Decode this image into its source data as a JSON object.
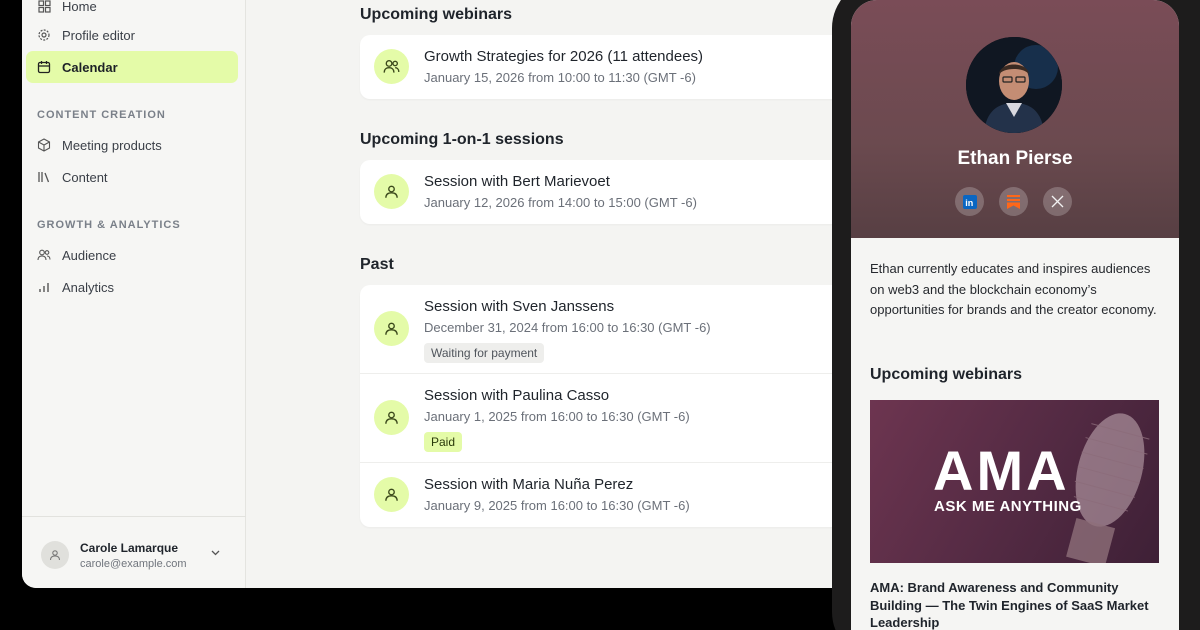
{
  "sidebar": {
    "nav_top": [
      {
        "label": "Home",
        "icon": "grid-icon"
      },
      {
        "label": "Profile editor",
        "icon": "gear-icon"
      },
      {
        "label": "Calendar",
        "icon": "calendar-icon",
        "active": true
      }
    ],
    "content_section": "CONTENT CREATION",
    "content_items": [
      {
        "label": "Meeting products",
        "icon": "box-icon"
      },
      {
        "label": "Content",
        "icon": "library-icon"
      }
    ],
    "growth_section": "GROWTH & ANALYTICS",
    "growth_items": [
      {
        "label": "Audience",
        "icon": "users-icon"
      },
      {
        "label": "Analytics",
        "icon": "bar-chart-icon"
      }
    ],
    "user": {
      "name": "Carole Lamarque",
      "email": "carole@example.com"
    }
  },
  "main": {
    "webinars_title": "Upcoming webinars",
    "webinars": [
      {
        "title": "Growth Strategies for 2026 (11 attendees)",
        "time": "January 15, 2026 from 10:00 to 11:30 (GMT -6)"
      }
    ],
    "sessions_title": "Upcoming 1-on-1 sessions",
    "sessions": [
      {
        "title": "Session with Bert Marievoet",
        "time": "January 12, 2026 from 14:00 to 15:00 (GMT -6)"
      }
    ],
    "past_title": "Past",
    "past": [
      {
        "title": "Session with Sven Janssens",
        "time": "December 31, 2024 from 16:00 to 16:30 (GMT -6)",
        "badge": "Waiting for payment"
      },
      {
        "title": "Session with Paulina Casso",
        "time": "January 1, 2025 from 16:00 to 16:30 (GMT -6)",
        "badge": "Paid"
      },
      {
        "title": "Session with Maria Nuña Perez",
        "time": "January 9, 2025 from 16:00 to 16:30 (GMT -6)"
      }
    ]
  },
  "phone": {
    "profile_name": "Ethan Pierse",
    "socials": [
      "linkedin-icon",
      "substack-icon",
      "x-icon"
    ],
    "bio": "Ethan currently educates and inspires audiences on web3 and the blockchain economy’s opportunities for brands and the creator economy.",
    "section_title": "Upcoming webinars",
    "webinar_image_title": "AMA",
    "webinar_image_subtitle": "ASK ME ANYTHING",
    "webinar_title": "AMA: Brand Awareness and Community Building — The Twin Engines of SaaS Market Leadership"
  },
  "colors": {
    "accent": "#e4fba8",
    "hero": "#6b4a4f",
    "background": "#f4f4f2"
  }
}
